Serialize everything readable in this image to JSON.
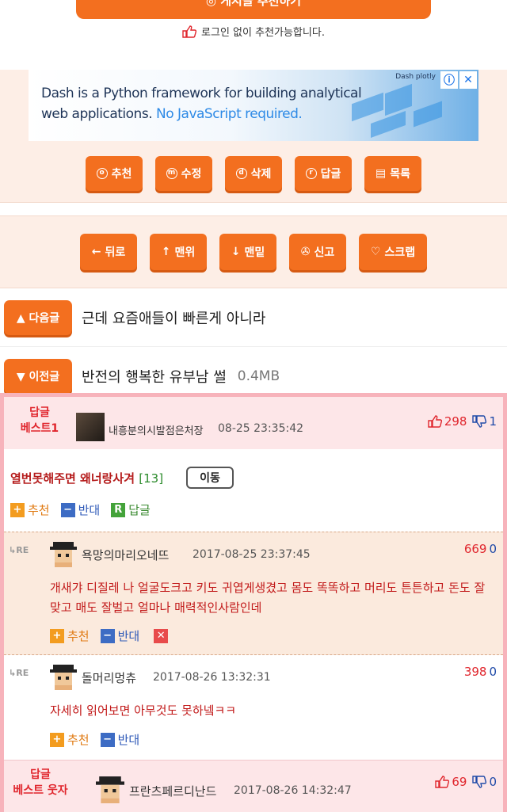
{
  "top": {
    "recommend_label": "◎ 게시글 추천하기",
    "login_note": "로그인 없이 추천가능합니다."
  },
  "ad": {
    "line1": "Dash is a Python framework for building analytical",
    "line2_a": "web applications. ",
    "line2_b": "No JavaScript required.",
    "brand": "Dash plotly",
    "info_glyph": "ⓘ",
    "close_glyph": "✕"
  },
  "actions1": [
    {
      "glyph": "o",
      "label": "추천",
      "name": "recommend-button"
    },
    {
      "glyph": "m",
      "label": "수정",
      "name": "edit-button"
    },
    {
      "glyph": "d",
      "label": "삭제",
      "name": "delete-button"
    },
    {
      "glyph": "r",
      "label": "답글",
      "name": "reply-button"
    },
    {
      "glyph": "▤",
      "label": "목록",
      "name": "list-button"
    }
  ],
  "actions2": [
    {
      "glyph": "←",
      "label": "뒤로",
      "name": "back-button"
    },
    {
      "glyph": "↑",
      "label": "맨위",
      "name": "top-button"
    },
    {
      "glyph": "↓",
      "label": "맨밑",
      "name": "bottom-button"
    },
    {
      "glyph": "✇",
      "label": "신고",
      "name": "report-button"
    },
    {
      "glyph": "♡",
      "label": "스크랩",
      "name": "scrap-button"
    }
  ],
  "nav": {
    "next_label": "▲ 다음글",
    "next_title": "근데 요즘애들이 빠른게 아니라",
    "prev_label": "▼ 이전글",
    "prev_title": "반전의 행복한 유부남 썰",
    "prev_size": "0.4MB"
  },
  "best_comment": {
    "label_line1": "답글",
    "label_line2": "베스트1",
    "user": "내흥분의시발점은처장",
    "date": "08-25 23:35:42",
    "up": "298",
    "down": "1",
    "title": "열번못해주면 왜너랑사겨",
    "count": "[13]",
    "move_label": "이동",
    "rec_label": "추천",
    "opp_label": "반대",
    "reply_label": "답글"
  },
  "replies": [
    {
      "re": "RE",
      "user": "욕망의마리오네뜨",
      "date": "2017-08-25 23:37:45",
      "up": "669",
      "down": "0",
      "text": "개새갸 디질레 나 얼굴도크고 키도 귀엽게생겼고 몸도 똑똑하고 머리도 튼튼하고 돈도 잘맞고 매도 잘벌고 얼마나 매력적인사람인데",
      "rec_label": "추천",
      "opp_label": "반대"
    },
    {
      "re": "RE",
      "user": "돌머리멍츄",
      "date": "2017-08-26 13:32:31",
      "up": "398",
      "down": "0",
      "text": "자세히 읽어보면 아무것도 못하넼ㅋㅋ",
      "rec_label": "추천",
      "opp_label": "반대"
    }
  ],
  "best2": {
    "label_line1": "답글",
    "label_line2": "베스트 웃자",
    "user": "프란츠페르디난드",
    "date": "2017-08-26 14:32:47",
    "up": "69",
    "down": "0"
  },
  "colors": {
    "accent": "#f36f1f",
    "best_bg": "#fde6e8",
    "reply_bg": "#fbeadd",
    "red_text": "#c21a1a"
  }
}
